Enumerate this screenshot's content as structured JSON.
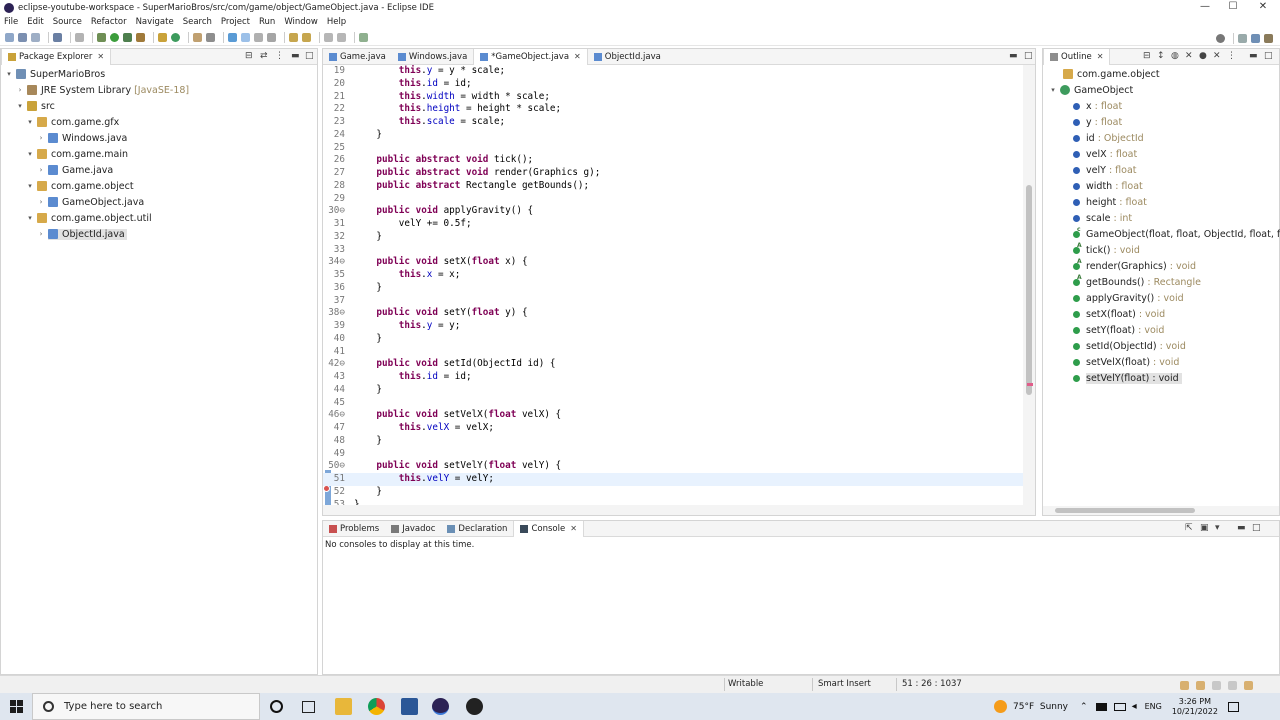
{
  "window": {
    "title": "eclipse-youtube-workspace - SuperMarioBros/src/com/game/object/GameObject.java - Eclipse IDE",
    "min": "—",
    "max": "☐",
    "close": "✕"
  },
  "menu": [
    "File",
    "Edit",
    "Source",
    "Refactor",
    "Navigate",
    "Search",
    "Project",
    "Run",
    "Window",
    "Help"
  ],
  "package_explorer": {
    "title": "Package Explorer",
    "nodes": [
      {
        "label": "SuperMarioBros",
        "extra": ""
      },
      {
        "label": "JRE System Library",
        "extra": "[JavaSE-18]"
      },
      {
        "label": "src",
        "extra": ""
      },
      {
        "label": "com.game.gfx",
        "extra": ""
      },
      {
        "label": "Windows.java",
        "extra": ""
      },
      {
        "label": "com.game.main",
        "extra": ""
      },
      {
        "label": "Game.java",
        "extra": ""
      },
      {
        "label": "com.game.object",
        "extra": ""
      },
      {
        "label": "GameObject.java",
        "extra": ""
      },
      {
        "label": "com.game.object.util",
        "extra": ""
      },
      {
        "label": "ObjectId.java",
        "extra": ""
      }
    ]
  },
  "editor": {
    "tabs": [
      {
        "label": "Game.java"
      },
      {
        "label": "Windows.java"
      },
      {
        "label": "*GameObject.java"
      },
      {
        "label": "ObjectId.java"
      }
    ],
    "lines": [
      {
        "n": "19",
        "text": "        this.y = y * scale;"
      },
      {
        "n": "20",
        "text": "        this.id = id;"
      },
      {
        "n": "21",
        "text": "        this.width = width * scale;"
      },
      {
        "n": "22",
        "text": "        this.height = height * scale;"
      },
      {
        "n": "23",
        "text": "        this.scale = scale;"
      },
      {
        "n": "24",
        "text": "    }"
      },
      {
        "n": "25",
        "text": ""
      },
      {
        "n": "26",
        "text": "    public abstract void tick();"
      },
      {
        "n": "27",
        "text": "    public abstract void render(Graphics g);"
      },
      {
        "n": "28",
        "text": "    public abstract Rectangle getBounds();"
      },
      {
        "n": "29",
        "text": ""
      },
      {
        "n": "30⊖",
        "text": "    public void applyGravity() {"
      },
      {
        "n": "31",
        "text": "        velY += 0.5f;"
      },
      {
        "n": "32",
        "text": "    }"
      },
      {
        "n": "33",
        "text": ""
      },
      {
        "n": "34⊖",
        "text": "    public void setX(float x) {"
      },
      {
        "n": "35",
        "text": "        this.x = x;"
      },
      {
        "n": "36",
        "text": "    }"
      },
      {
        "n": "37",
        "text": ""
      },
      {
        "n": "38⊖",
        "text": "    public void setY(float y) {"
      },
      {
        "n": "39",
        "text": "        this.y = y;"
      },
      {
        "n": "40",
        "text": "    }"
      },
      {
        "n": "41",
        "text": ""
      },
      {
        "n": "42⊖",
        "text": "    public void setId(ObjectId id) {"
      },
      {
        "n": "43",
        "text": "        this.id = id;"
      },
      {
        "n": "44",
        "text": "    }"
      },
      {
        "n": "45",
        "text": ""
      },
      {
        "n": "46⊖",
        "text": "    public void setVelX(float velX) {"
      },
      {
        "n": "47",
        "text": "        this.velX = velX;"
      },
      {
        "n": "48",
        "text": "    }"
      },
      {
        "n": "49",
        "text": ""
      },
      {
        "n": "50⊖",
        "text": "    public void setVelY(float velY) {"
      },
      {
        "n": "51",
        "text": "        this.velY = velY;"
      },
      {
        "n": "52",
        "text": "    }"
      },
      {
        "n": "53",
        "text": "}"
      }
    ]
  },
  "outline": {
    "title": "Outline",
    "package": "com.game.object",
    "class": "GameObject",
    "members": [
      {
        "name": "x",
        "type": " : float",
        "kind": "field"
      },
      {
        "name": "y",
        "type": " : float",
        "kind": "field"
      },
      {
        "name": "id",
        "type": " : ObjectId",
        "kind": "field"
      },
      {
        "name": "velX",
        "type": " : float",
        "kind": "field"
      },
      {
        "name": "velY",
        "type": " : float",
        "kind": "field"
      },
      {
        "name": "width",
        "type": " : float",
        "kind": "field"
      },
      {
        "name": "height",
        "type": " : float",
        "kind": "field"
      },
      {
        "name": "scale",
        "type": " : int",
        "kind": "field"
      },
      {
        "name": "GameObject(float, float, ObjectId, float, flo",
        "type": "",
        "kind": "ctor"
      },
      {
        "name": "tick()",
        "type": " : void",
        "kind": "abs"
      },
      {
        "name": "render(Graphics)",
        "type": " : void",
        "kind": "abs"
      },
      {
        "name": "getBounds()",
        "type": " : Rectangle",
        "kind": "abs"
      },
      {
        "name": "applyGravity()",
        "type": " : void",
        "kind": "method"
      },
      {
        "name": "setX(float)",
        "type": " : void",
        "kind": "method"
      },
      {
        "name": "setY(float)",
        "type": " : void",
        "kind": "method"
      },
      {
        "name": "setId(ObjectId)",
        "type": " : void",
        "kind": "method"
      },
      {
        "name": "setVelX(float)",
        "type": " : void",
        "kind": "method"
      },
      {
        "name": "setVelY(float) : void",
        "type": "",
        "kind": "method"
      }
    ]
  },
  "bottom_panel": {
    "tabs": [
      {
        "label": "Problems"
      },
      {
        "label": "Javadoc"
      },
      {
        "label": "Declaration"
      },
      {
        "label": "Console"
      }
    ],
    "message": "No consoles to display at this time."
  },
  "statusbar": {
    "mode": "Writable",
    "insert": "Smart Insert",
    "position": "51 : 26 : 1037"
  },
  "taskbar": {
    "search_placeholder": "Type here to search",
    "weather": "75°F  Sunny",
    "lang": "ENG",
    "time": "3:26 PM",
    "date": "10/21/2022"
  }
}
